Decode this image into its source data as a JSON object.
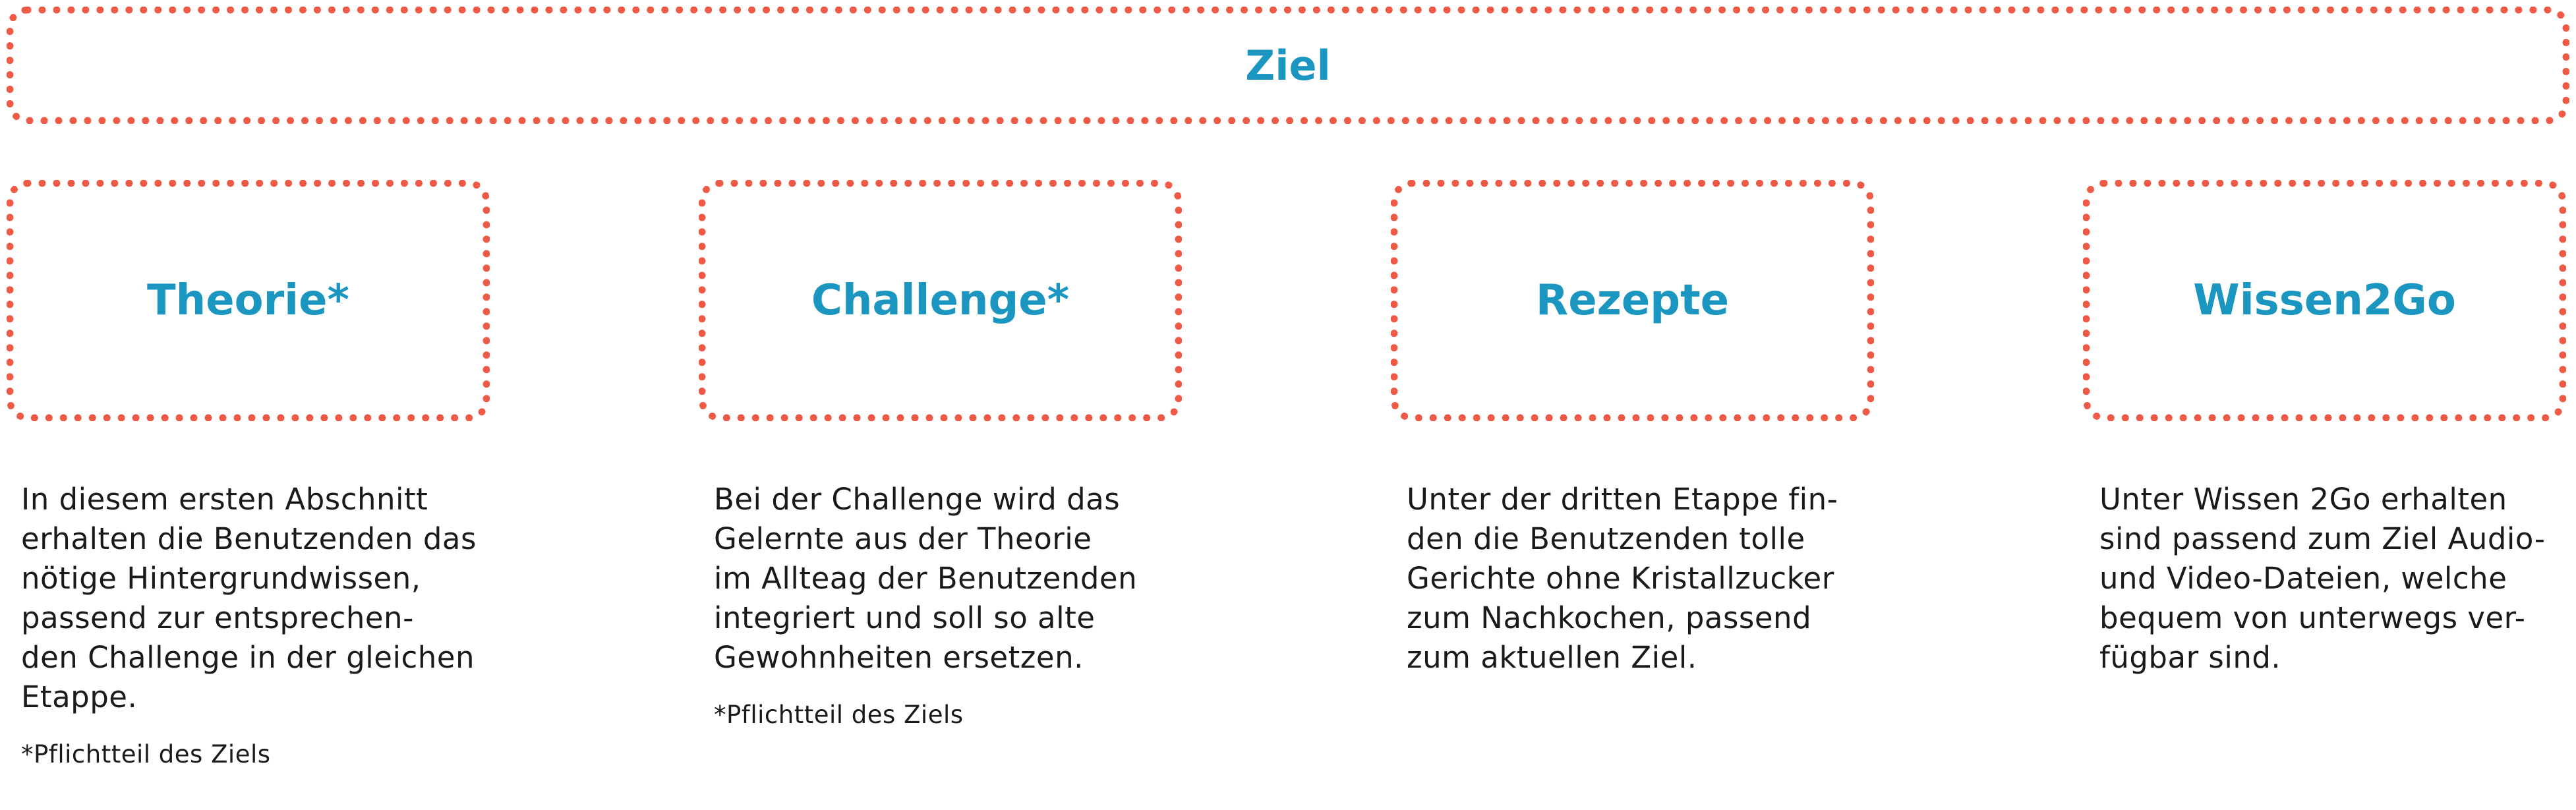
{
  "goal": {
    "title": "Ziel"
  },
  "columns": [
    {
      "title": "Theorie*",
      "lines": [
        "In diesem ersten Abschnitt",
        "erhalten die Benutzenden das",
        "nötige Hintergrundwissen,",
        "passend zur entsprechen-",
        "den Challenge in der gleichen",
        "Etappe."
      ],
      "note": "*Pflichtteil des Ziels"
    },
    {
      "title": "Challenge*",
      "lines": [
        "Bei der Challenge wird das",
        "Gelernte aus der Theorie",
        "im Allteag der Benutzenden",
        "integriert und soll so alte",
        "Gewohnheiten ersetzen."
      ],
      "note": "*Pflichtteil des Ziels"
    },
    {
      "title": "Rezepte",
      "lines": [
        "Unter der dritten Etappe fin-",
        "den die Benutzenden tolle",
        "Gerichte ohne Kristallzucker",
        "zum Nachkochen, passend",
        "zum aktuellen Ziel."
      ],
      "note": ""
    },
    {
      "title": "Wissen2Go",
      "lines": [
        "Unter Wissen 2Go erhalten",
        "sind passend zum Ziel Audio-",
        "und Video-Dateien, welche",
        "bequem von unterwegs ver-",
        "fügbar sind."
      ],
      "note": ""
    }
  ],
  "colors": {
    "border": "#ee5a45",
    "title": "#1a96c0",
    "text": "#1a1a1a"
  }
}
